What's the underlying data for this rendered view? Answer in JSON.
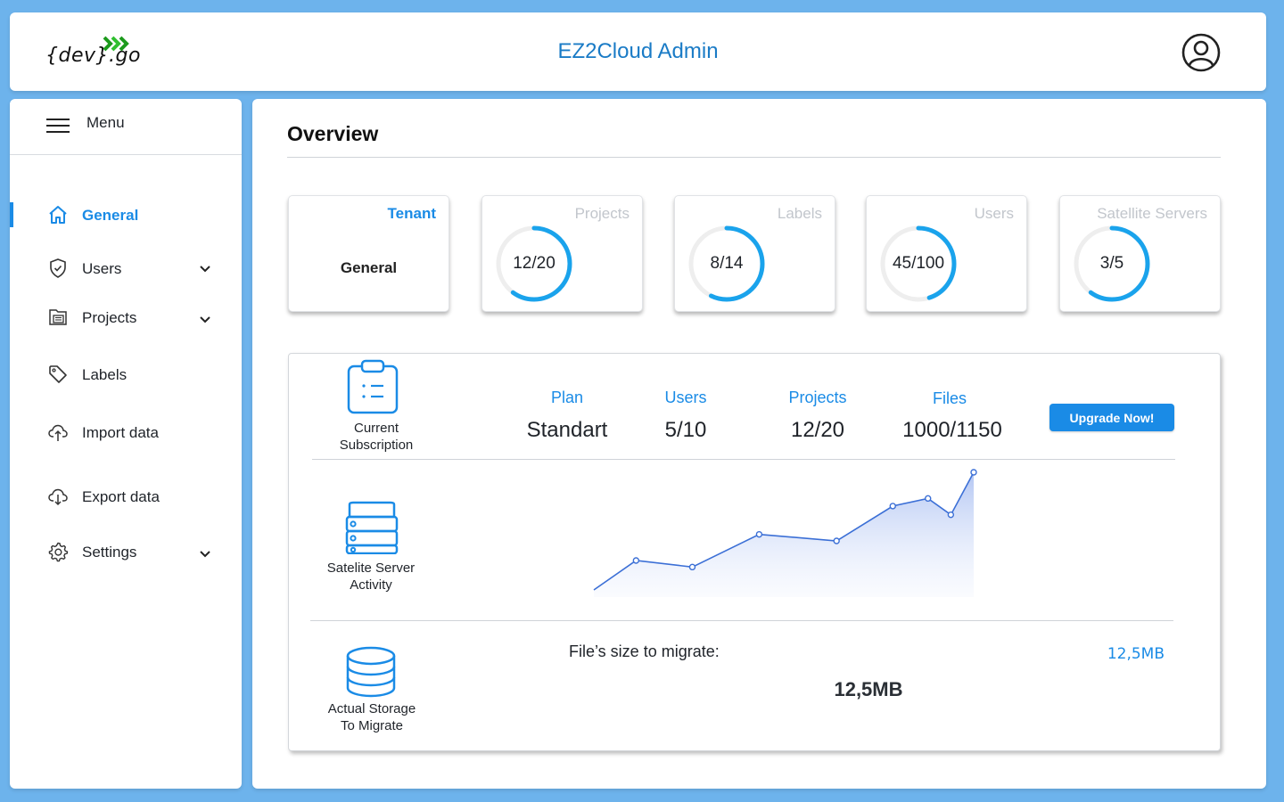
{
  "header": {
    "logo_text": "{dev}.go",
    "app_title": "EZ2Cloud Admin",
    "logo_arrow_color": "#2fbf2f",
    "avatar_icon": "user-circle-icon"
  },
  "sidebar": {
    "menu_label": "Menu",
    "items": [
      {
        "label": "General",
        "icon": "home-icon",
        "active": true,
        "expandable": false
      },
      {
        "label": "Users",
        "icon": "shield-icon",
        "active": false,
        "expandable": true
      },
      {
        "label": "Projects",
        "icon": "projects-icon",
        "active": false,
        "expandable": true
      },
      {
        "label": "Labels",
        "icon": "tag-icon",
        "active": false,
        "expandable": false
      },
      {
        "label": "Import data",
        "icon": "cloud-upload-icon",
        "active": false,
        "expandable": false
      },
      {
        "label": "Export data",
        "icon": "cloud-download-icon",
        "active": false,
        "expandable": false
      },
      {
        "label": "Settings",
        "icon": "gear-icon",
        "active": false,
        "expandable": true
      }
    ]
  },
  "main": {
    "title": "Overview",
    "cards": [
      {
        "title": "Tenant",
        "value": "General"
      },
      {
        "title": "Projects",
        "value": "12/20",
        "fraction": 0.6
      },
      {
        "title": "Labels",
        "value": "8/14",
        "fraction": 0.5714
      },
      {
        "title": "Users",
        "value": "45/100",
        "fraction": 0.45
      },
      {
        "title": "Satellite Servers",
        "value": "3/5",
        "fraction": 0.6
      }
    ],
    "subscription": {
      "label_line1": "Current",
      "label_line2": "Subscription",
      "stats": [
        {
          "key": "Plan",
          "value": "Standart"
        },
        {
          "key": "Users",
          "value": "5/10"
        },
        {
          "key": "Projects",
          "value": "12/20"
        },
        {
          "key": "Files",
          "value": "1000/1150"
        }
      ],
      "upgrade_label": "Upgrade Now!"
    },
    "activity": {
      "label_line1": "Satelite Server",
      "label_line2": "Activity"
    },
    "storage": {
      "label_line1": "Actual Storage",
      "label_line2": "To Migrate",
      "migrate_label": "File’s size to migrate:",
      "migrate_value": "12,5MB",
      "migrate_link": "12,5MB"
    }
  },
  "colors": {
    "accent": "#1a8be6",
    "ring": "#1aa3ec",
    "ring_track": "#eeeeee",
    "background": "#6db3ec"
  },
  "chart_data": {
    "type": "area",
    "x": [
      1,
      2,
      3,
      4,
      5,
      6,
      7,
      8,
      9
    ],
    "values": [
      0,
      27,
      21,
      51,
      45,
      77,
      84,
      69,
      108
    ],
    "title": "",
    "xlabel": "",
    "ylabel": "",
    "grid": false
  }
}
